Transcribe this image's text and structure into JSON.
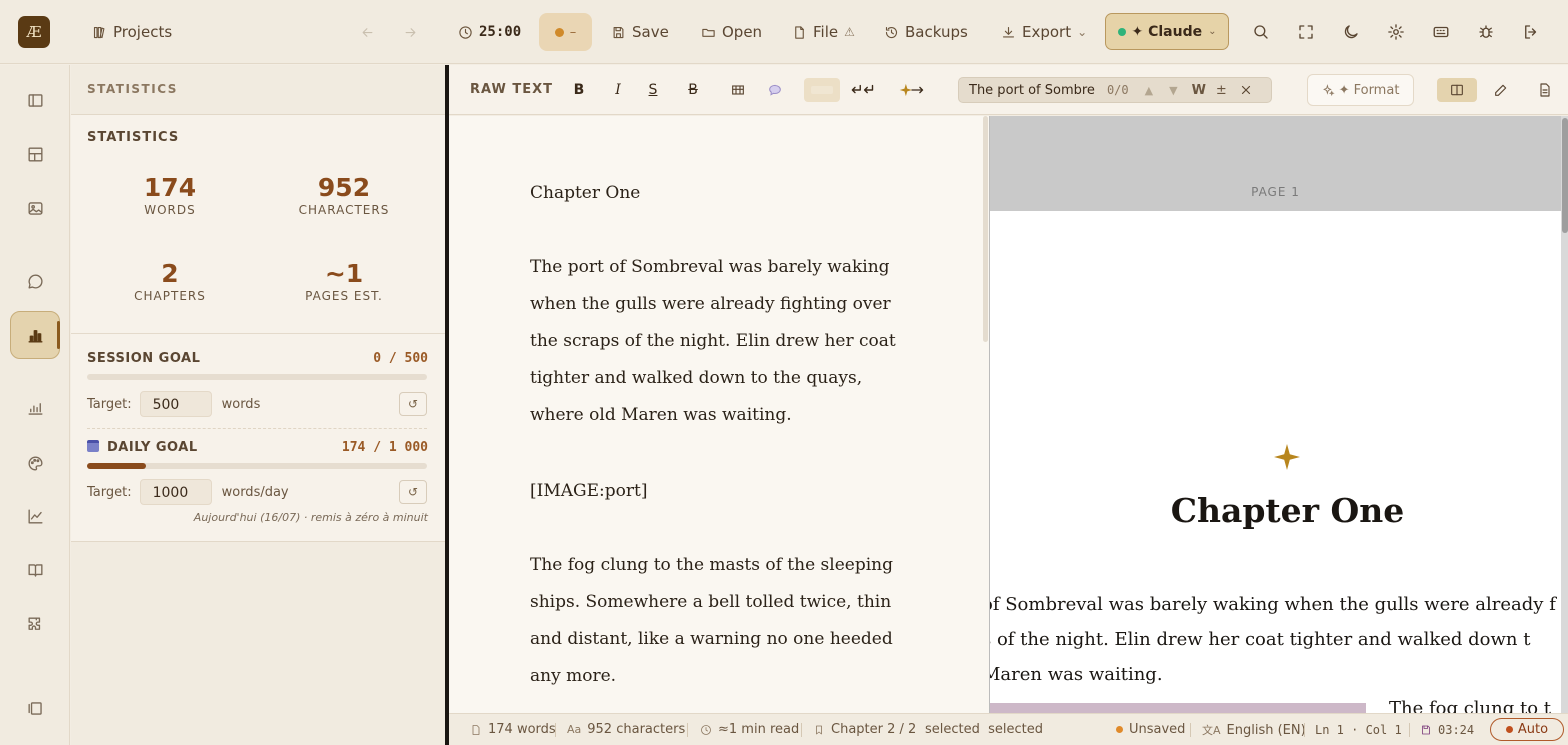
{
  "toolbar": {
    "logo": "Æ",
    "projects_label": "Projects",
    "timer": "25:00",
    "pomodoro_label": "–",
    "save_label": "Save",
    "open_label": "Open",
    "file_label": "File",
    "file_warning": "⚠",
    "backups_label": "Backups",
    "export_label": "Export",
    "ai_label": "✦ Claude",
    "ai_status_color": "#2fb37a"
  },
  "panel": {
    "header": "STATISTICS",
    "section_title": "STATISTICS",
    "stats": [
      {
        "value": "174",
        "label": "WORDS"
      },
      {
        "value": "952",
        "label": "CHARACTERS"
      },
      {
        "value": "2",
        "label": "CHAPTERS"
      },
      {
        "value": "~1",
        "label": "PAGES EST."
      }
    ],
    "session_goal": {
      "title": "SESSION GOAL",
      "value": "0 / 500",
      "progress": 0,
      "target_label": "Target:",
      "target_value": "500",
      "unit": "words",
      "reset": "↺"
    },
    "daily_goal": {
      "title": "DAILY GOAL",
      "value": "174 / 1 000",
      "progress": 0.174,
      "target_label": "Target:",
      "target_value": "1000",
      "unit": "words/day",
      "reset": "↺",
      "note": "Aujourd'hui (16/07) · remis à zéro à minuit"
    }
  },
  "editor_toolbar": {
    "mode_label": "RAW TEXT",
    "bold": "B",
    "italic": "I",
    "underline": "S",
    "strike": "B",
    "search_value": "The port of Sombre",
    "search_count": "0/0",
    "search_prev": "▲",
    "search_next": "▼",
    "search_whole_word": "W",
    "search_case": "±",
    "format_label": "✦ Format"
  },
  "editor": {
    "heading": "Chapter One",
    "para1": "The port of Sombreval was barely waking when the gulls were already fighting over the scraps of the night. Elin drew her coat tighter and walked down to the quays, where old Maren was waiting.",
    "image_tag": "[IMAGE:port]",
    "para2": "The fog clung to the masts of the sleeping ships. Somewhere a bell tolled twice, thin and distant, like a warning no one heeded any more."
  },
  "preview": {
    "page_label": "PAGE 1",
    "title": "Chapter One",
    "line1": "of Sombreval was barely waking when the gulls were already f",
    "line2": "s of the night. Elin drew her coat tighter and walked down t",
    "line3": " Maren was waiting.",
    "fog_fragment": "The fog clung to t",
    "accent_color": "#b8861e"
  },
  "status": {
    "words": "174 words",
    "characters": "952 characters",
    "read_time": "≈1 min read",
    "chapter": "Chapter 2 / 2",
    "selection": "selected  selected",
    "unsaved": "Unsaved",
    "language": "English (EN)",
    "cursor": "Ln 1 · Col 1",
    "time": "03:24",
    "auto": "Auto"
  }
}
